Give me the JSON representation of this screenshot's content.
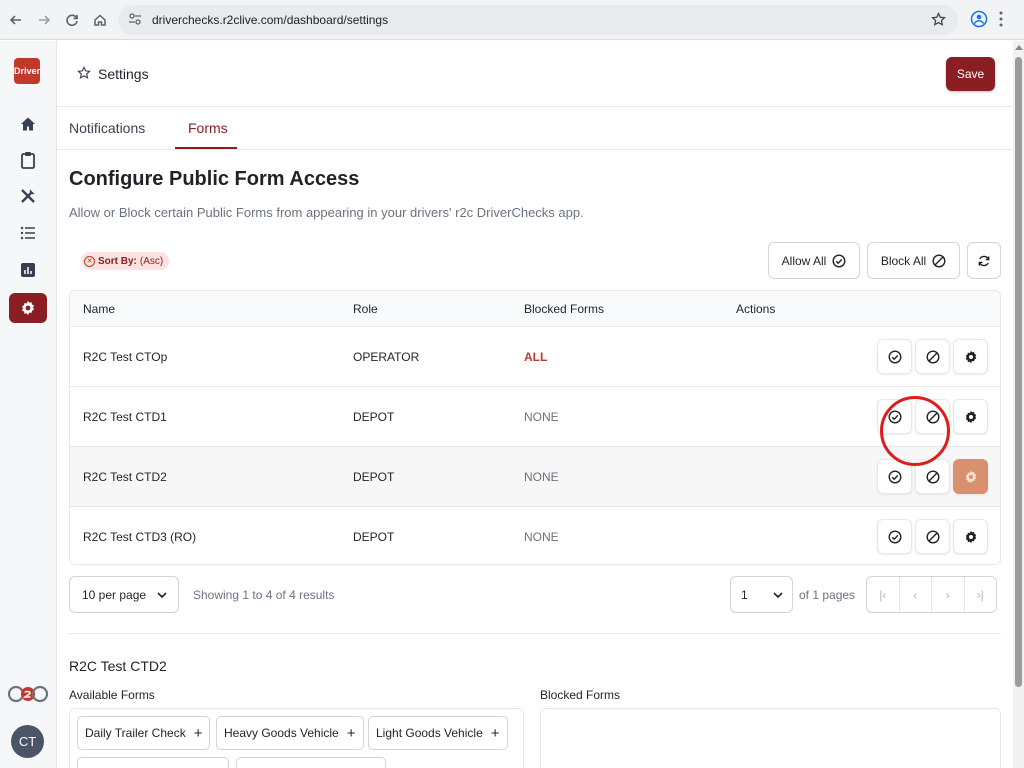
{
  "browser": {
    "url": "driverchecks.r2clive.com/dashboard/settings"
  },
  "sidebar": {
    "logo_text": "Driver",
    "items": [
      {
        "name": "home",
        "icon": "home-icon"
      },
      {
        "name": "clipboard",
        "icon": "clipboard-icon"
      },
      {
        "name": "tools",
        "icon": "tools-icon"
      },
      {
        "name": "list",
        "icon": "list-icon"
      },
      {
        "name": "reports",
        "icon": "chart-icon"
      },
      {
        "name": "settings",
        "icon": "gear-icon",
        "active": true
      }
    ],
    "brand": "r2c",
    "avatar_initials": "CT"
  },
  "header": {
    "title": "Settings",
    "save_label": "Save"
  },
  "tabs": [
    {
      "label": "Notifications",
      "active": false
    },
    {
      "label": "Forms",
      "active": true
    }
  ],
  "section": {
    "title": "Configure Public Form Access",
    "description": "Allow or Block certain Public Forms from appearing in your drivers' r2c DriverChecks app."
  },
  "sort": {
    "label": "Sort By:",
    "value": "(Asc)"
  },
  "actions": {
    "allow_all": "Allow All",
    "block_all": "Block All"
  },
  "table": {
    "columns": [
      "Name",
      "Role",
      "Blocked Forms",
      "Actions"
    ],
    "rows": [
      {
        "name": "R2C Test CTOp",
        "role": "OPERATOR",
        "blocked": "ALL"
      },
      {
        "name": "R2C Test CTD1",
        "role": "DEPOT",
        "blocked": "NONE"
      },
      {
        "name": "R2C Test CTD2",
        "role": "DEPOT",
        "blocked": "NONE"
      },
      {
        "name": "R2C Test CTD3 (RO)",
        "role": "DEPOT",
        "blocked": "NONE"
      }
    ]
  },
  "pagination": {
    "per_page": "10 per page",
    "showing": "Showing 1 to 4 of 4 results",
    "page": "1",
    "of_pages": "of 1 pages"
  },
  "detail": {
    "selected_name": "R2C Test CTD2",
    "available_label": "Available Forms",
    "blocked_label": "Blocked Forms",
    "available_forms": [
      "Daily Trailer Check",
      "Heavy Goods Vehicle",
      "Light Goods Vehicle"
    ]
  },
  "colors": {
    "brand": "#8b1e23",
    "highlight": "#d9906e",
    "annotation": "#e01b1b"
  }
}
